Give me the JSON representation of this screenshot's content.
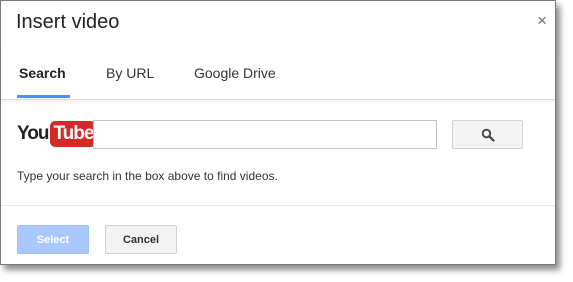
{
  "dialog": {
    "title": "Insert video",
    "close_glyph": "×"
  },
  "tabs": [
    {
      "label": "Search",
      "active": true
    },
    {
      "label": "By URL",
      "active": false
    },
    {
      "label": "Google Drive",
      "active": false
    }
  ],
  "search": {
    "logo_you": "You",
    "logo_tube": "Tube",
    "value": "",
    "placeholder": "",
    "button_icon": "magnifier-icon",
    "hint": "Type your search in the box above to find videos."
  },
  "footer": {
    "select_label": "Select",
    "cancel_label": "Cancel"
  },
  "colors": {
    "accent": "#4d90fe",
    "select_disabled": "#a9c8fb",
    "youtube_red": "#d22b27"
  }
}
